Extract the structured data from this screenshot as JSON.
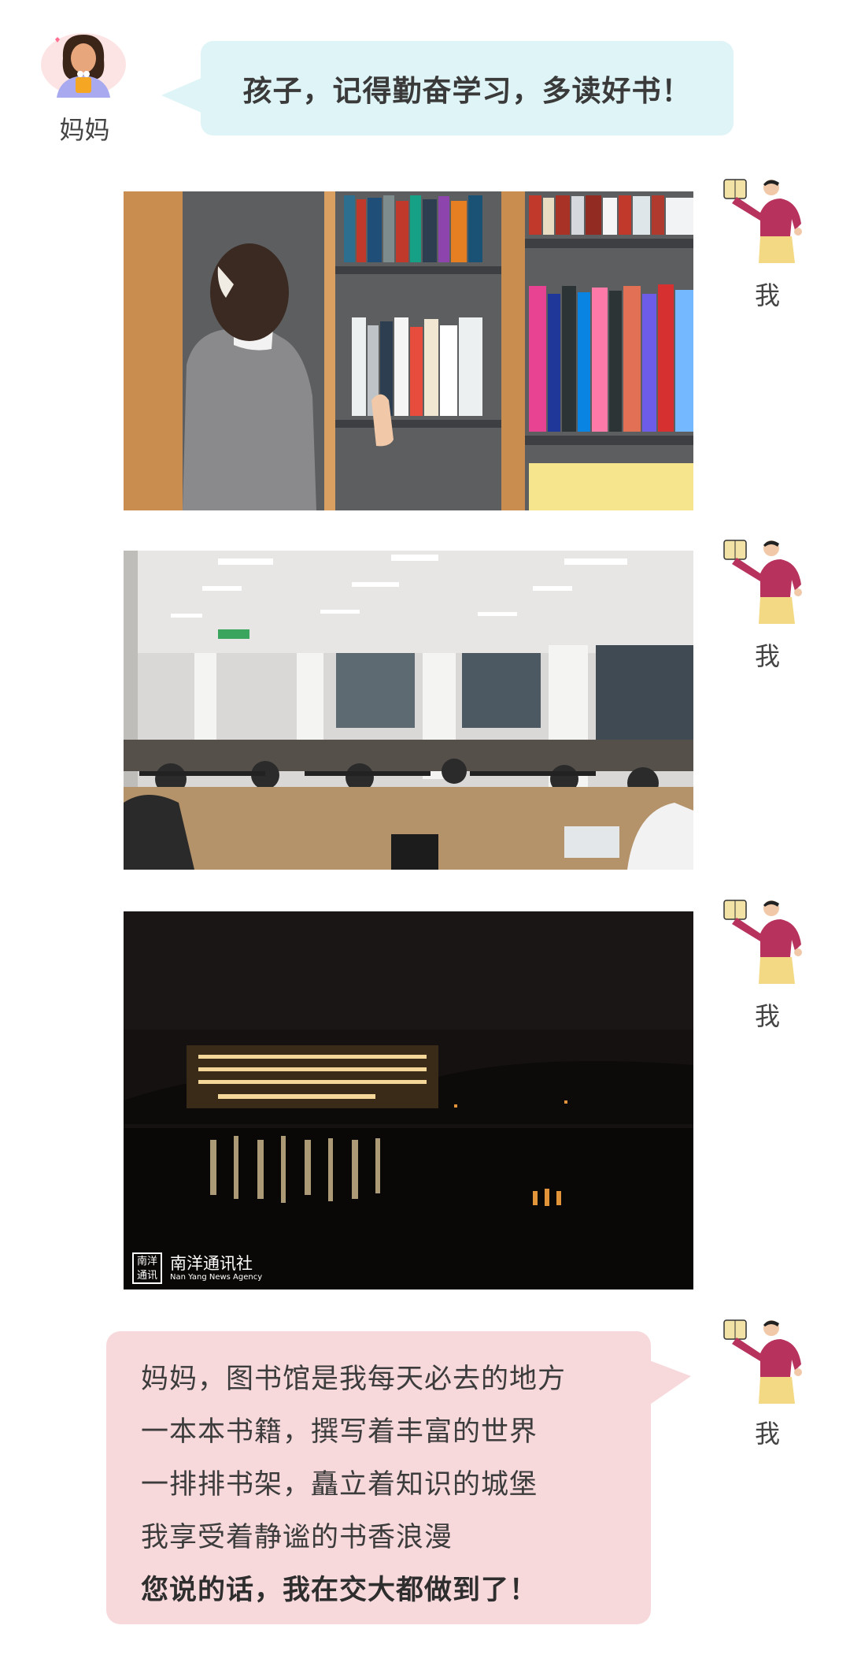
{
  "mom": {
    "name": "妈妈",
    "message": "孩子，记得勤奋学习，多读好书！",
    "bubble_color": "#dff4f6"
  },
  "me": {
    "name": "我",
    "bubble_color": "#f7d9dc",
    "lines": [
      "妈妈，图书馆是我每天必去的地方",
      "一本本书籍，撰写着丰富的世界",
      "一排排书架，矗立着知识的城堡",
      "我享受着静谧的书香浪漫",
      "您说的话，我在交大都做到了！"
    ]
  },
  "photos": [
    {
      "subject": "bookshelf-photo"
    },
    {
      "subject": "reading-room-photo"
    },
    {
      "subject": "library-at-night-photo"
    }
  ],
  "watermark": {
    "seal": "南洋通讯",
    "name_cn": "南洋通讯社",
    "name_en": "Nan Yang News Agency"
  }
}
